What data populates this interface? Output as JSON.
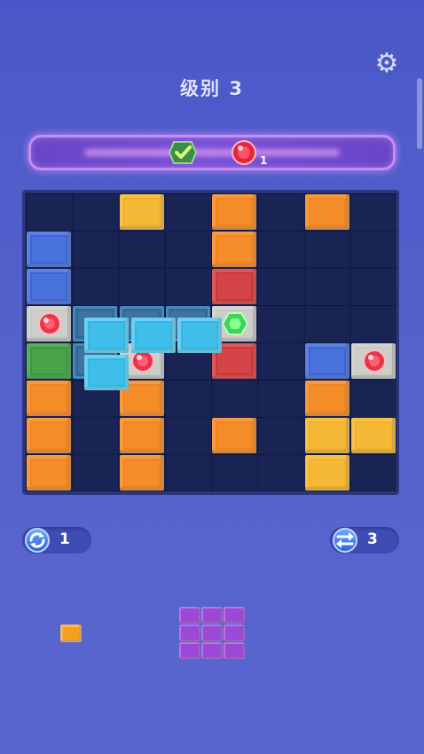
{
  "header": {
    "level_title": "级别 3",
    "settings_icon": "gear-icon"
  },
  "goal": {
    "completed_icon": "checkmark-gem-icon",
    "target_icon": "red-gem-icon",
    "remaining": "1"
  },
  "board": {
    "columns": 8,
    "rows": 8,
    "cells": [
      [
        "empty",
        "empty",
        "yellow",
        "empty",
        "orange",
        "empty",
        "orange",
        "empty"
      ],
      [
        "blue",
        "empty",
        "empty",
        "empty",
        "orange",
        "empty",
        "empty",
        "empty"
      ],
      [
        "blue",
        "empty",
        "empty",
        "empty",
        "red",
        "empty",
        "empty",
        "empty"
      ],
      [
        "gray-red-gem",
        "empty",
        "empty",
        "empty",
        "gray-green-gem",
        "empty",
        "empty",
        "empty"
      ],
      [
        "green",
        "empty",
        "gray-red-gem",
        "empty",
        "red",
        "empty",
        "blue",
        "gray-red-gem"
      ],
      [
        "orange",
        "empty",
        "orange",
        "empty",
        "empty",
        "empty",
        "orange",
        "empty"
      ],
      [
        "orange",
        "empty",
        "orange",
        "empty",
        "orange",
        "empty",
        "yellow",
        "yellow"
      ],
      [
        "orange",
        "empty",
        "orange",
        "empty",
        "empty",
        "empty",
        "yellow",
        "empty"
      ]
    ],
    "dragging_piece": {
      "color": "cyan",
      "cells": [
        [
          3,
          1
        ],
        [
          3,
          2
        ],
        [
          3,
          3
        ],
        [
          4,
          1
        ]
      ]
    }
  },
  "powerups": {
    "refresh": {
      "icon": "refresh-icon",
      "count": "1"
    },
    "swap": {
      "icon": "swap-icon",
      "count": "3"
    }
  },
  "tray": {
    "pieces": [
      {
        "name": "single-block",
        "color": "orange",
        "size": "1x1"
      },
      {
        "name": "square-block",
        "color": "purple",
        "size": "3x3"
      }
    ]
  },
  "colors": {
    "orange": "#f58419",
    "yellow": "#f5b227",
    "blue": "#3a67d8",
    "red": "#d23537",
    "green": "#3b9c3c",
    "gray": "#c9c9c6",
    "cyan": "#2fb9e8",
    "purple": "#9b49d6",
    "background": "#4f5bcb"
  }
}
